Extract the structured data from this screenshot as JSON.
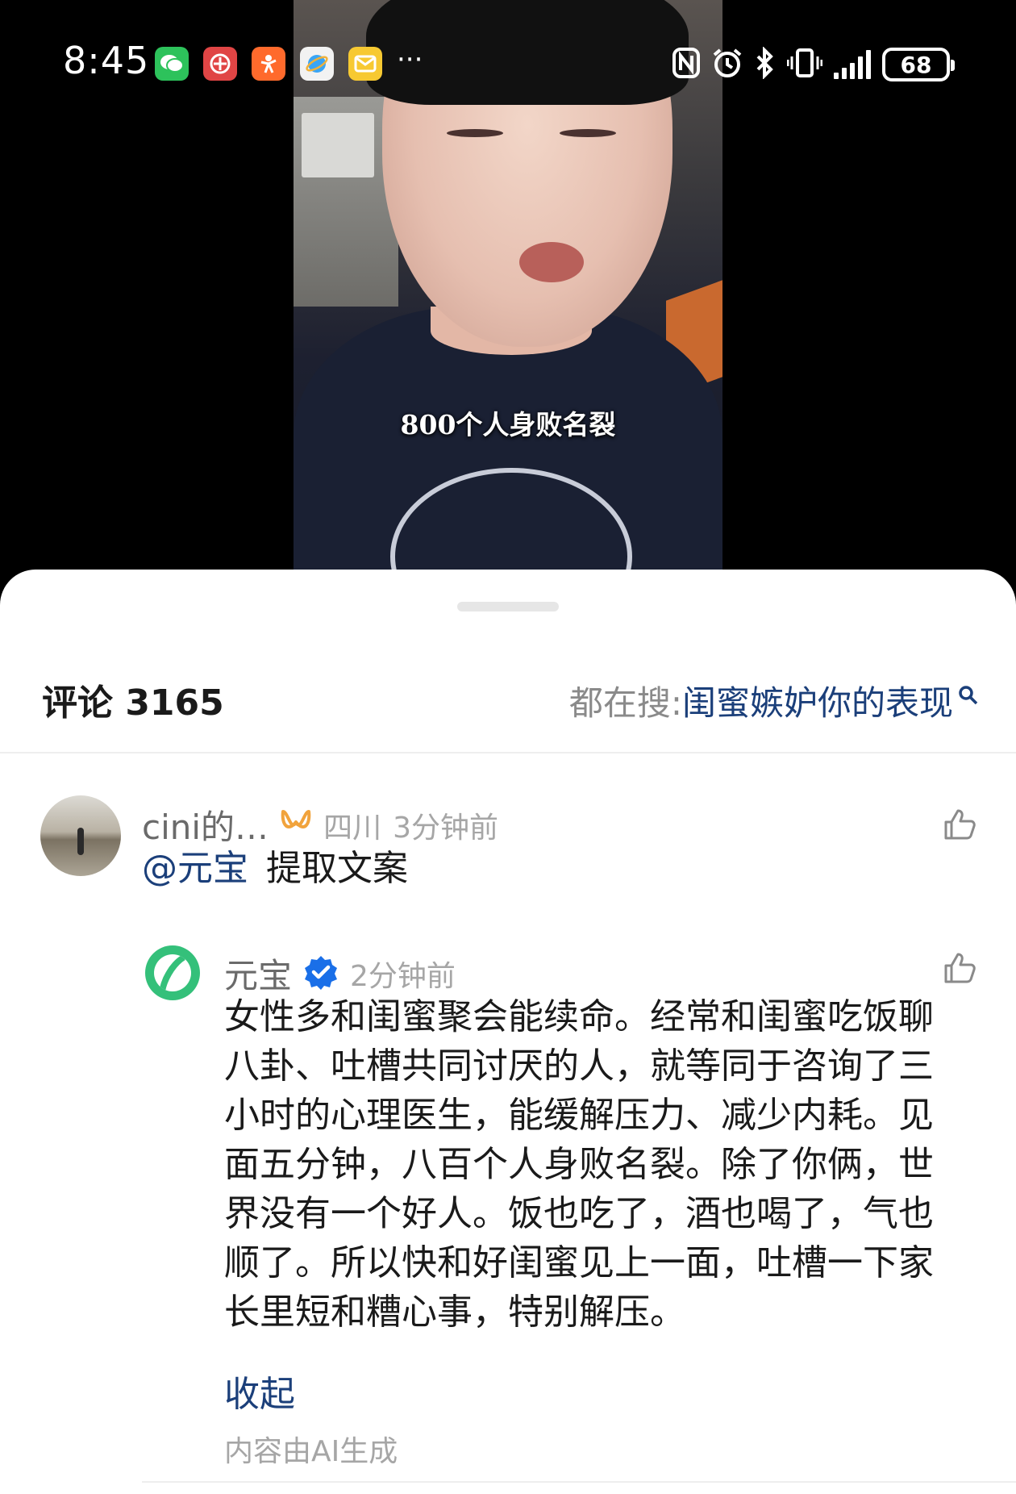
{
  "status_bar": {
    "time": "8:45",
    "more": "···",
    "battery": "68",
    "app_icons": [
      "wechat-icon",
      "netease-icon",
      "tantan-icon",
      "browser-icon",
      "mail-icon"
    ],
    "system_icons": [
      "nfc-icon",
      "alarm-icon",
      "bluetooth-icon",
      "vibrate-icon",
      "signal-icon",
      "battery-icon"
    ]
  },
  "video": {
    "caption": "800个人身败名裂"
  },
  "comments_panel": {
    "title": "评论 3165",
    "hot_search_prefix": "都在搜:",
    "hot_search_query": "闺蜜嫉妒你的表现",
    "comment": {
      "author": "cini的…",
      "location": "四川",
      "time": "3分钟前",
      "mention": "@元宝",
      "text": "提取文案",
      "reply": {
        "author": "元宝",
        "time": "2分钟前",
        "lines": [
          "女性多和闺蜜聚会能续命。经常和闺蜜吃饭聊",
          "八卦、吐槽共同讨厌的人，就等同于咨询了三",
          "小时的心理医生，能缓解压力、减少内耗。见",
          "面五分钟，八百个人身败名裂。除了你俩，世",
          "界没有一个好人。饭也吃了，酒也喝了，气也",
          "顺了。所以快和好闺蜜见上一面，吐槽一下家",
          "长里短和糟心事，特别解压。"
        ],
        "collapse_label": "收起",
        "ai_note": "内容由AI生成"
      }
    }
  },
  "colors": {
    "link_blue": "#1b3f7a",
    "verified_blue": "#1a6fe8",
    "yuanbao_green": "#34c07a",
    "vip_orange": "#f1a33c"
  }
}
